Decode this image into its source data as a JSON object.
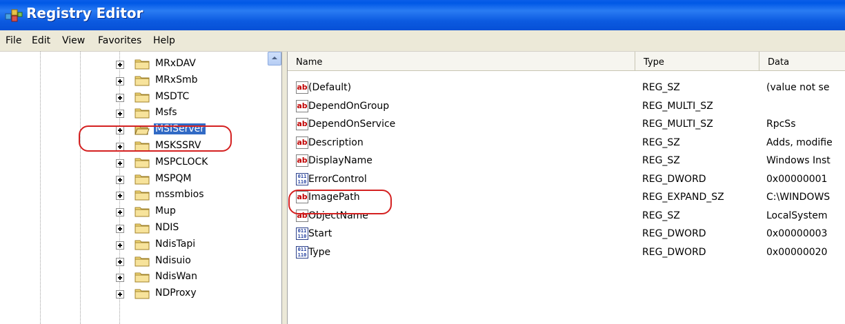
{
  "window": {
    "title": "Registry Editor",
    "app_icon": "registry-editor-icon"
  },
  "menu": [
    "File",
    "Edit",
    "View",
    "Favorites",
    "Help"
  ],
  "tree": {
    "items": [
      {
        "label": "MRxDAV",
        "selected": false
      },
      {
        "label": "MRxSmb",
        "selected": false
      },
      {
        "label": "MSDTC",
        "selected": false
      },
      {
        "label": "Msfs",
        "selected": false
      },
      {
        "label": "MSIServer",
        "selected": true
      },
      {
        "label": "MSKSSRV",
        "selected": false
      },
      {
        "label": "MSPCLOCK",
        "selected": false
      },
      {
        "label": "MSPQM",
        "selected": false
      },
      {
        "label": "mssmbios",
        "selected": false
      },
      {
        "label": "Mup",
        "selected": false
      },
      {
        "label": "NDIS",
        "selected": false
      },
      {
        "label": "NdisTapi",
        "selected": false
      },
      {
        "label": "Ndisuio",
        "selected": false
      },
      {
        "label": "NdisWan",
        "selected": false
      },
      {
        "label": "NDProxy",
        "selected": false
      }
    ]
  },
  "values": {
    "columns": {
      "name": "Name",
      "type": "Type",
      "data": "Data"
    },
    "rows": [
      {
        "icon": "string-value-icon",
        "name": "(Default)",
        "type": "REG_SZ",
        "data": "(value not se"
      },
      {
        "icon": "string-value-icon",
        "name": "DependOnGroup",
        "type": "REG_MULTI_SZ",
        "data": ""
      },
      {
        "icon": "string-value-icon",
        "name": "DependOnService",
        "type": "REG_MULTI_SZ",
        "data": "RpcSs"
      },
      {
        "icon": "string-value-icon",
        "name": "Description",
        "type": "REG_SZ",
        "data": "Adds, modifie"
      },
      {
        "icon": "string-value-icon",
        "name": "DisplayName",
        "type": "REG_SZ",
        "data": "Windows Inst"
      },
      {
        "icon": "binary-value-icon",
        "name": "ErrorControl",
        "type": "REG_DWORD",
        "data": "0x00000001"
      },
      {
        "icon": "string-value-icon",
        "name": "ImagePath",
        "type": "REG_EXPAND_SZ",
        "data": "C:\\WINDOWS"
      },
      {
        "icon": "string-value-icon",
        "name": "ObjectName",
        "type": "REG_SZ",
        "data": "LocalSystem"
      },
      {
        "icon": "binary-value-icon",
        "name": "Start",
        "type": "REG_DWORD",
        "data": "0x00000003"
      },
      {
        "icon": "binary-value-icon",
        "name": "Type",
        "type": "REG_DWORD",
        "data": "0x00000020"
      }
    ]
  },
  "colors": {
    "titlebar": "#0058e6",
    "selection": "#316ac5",
    "highlight_oval": "#d42020"
  }
}
